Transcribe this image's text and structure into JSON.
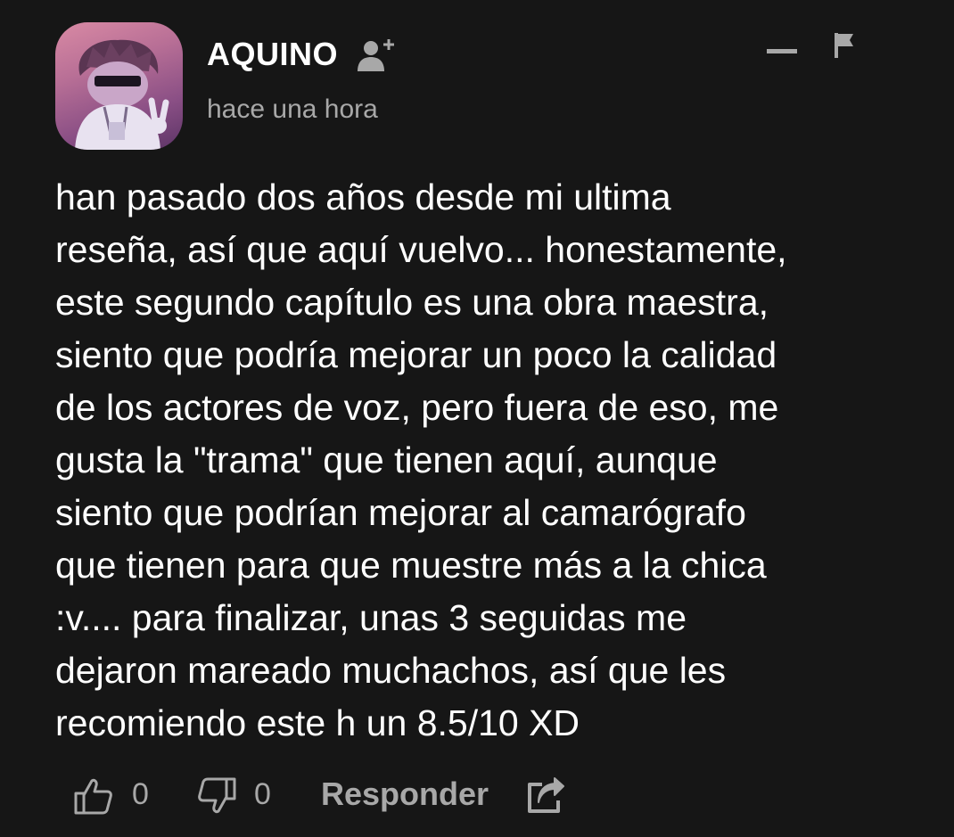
{
  "comment": {
    "author": "AQUINO",
    "time": "hace una hora",
    "text": "han pasado dos años desde mi ultima\nreseña, así que aquí vuelvo... honestamente,\neste segundo capítulo es una obra maestra,\nsiento que podría mejorar un poco la calidad\nde los actores de voz, pero fuera de eso, me\ngusta la \"trama\" que tienen aquí, aunque\nsiento que podrían mejorar al camarógrafo\nque tienen para que muestre más a la chica\n:v.... para finalizar, unas 3 seguidas me\ndejaron mareado muchachos, así que les\nrecomiendo este h un 8.5/10 XD"
  },
  "actions": {
    "likes": "0",
    "dislikes": "0",
    "reply_label": "Responder"
  },
  "icons": {
    "follow": "add-user-icon",
    "collapse": "minus-icon",
    "report": "flag-icon",
    "like": "thumbs-up-icon",
    "dislike": "thumbs-down-icon",
    "share": "share-icon"
  },
  "colors": {
    "background": "#161616",
    "primary_text": "#ffffff",
    "secondary_text": "#a8a8a8"
  }
}
